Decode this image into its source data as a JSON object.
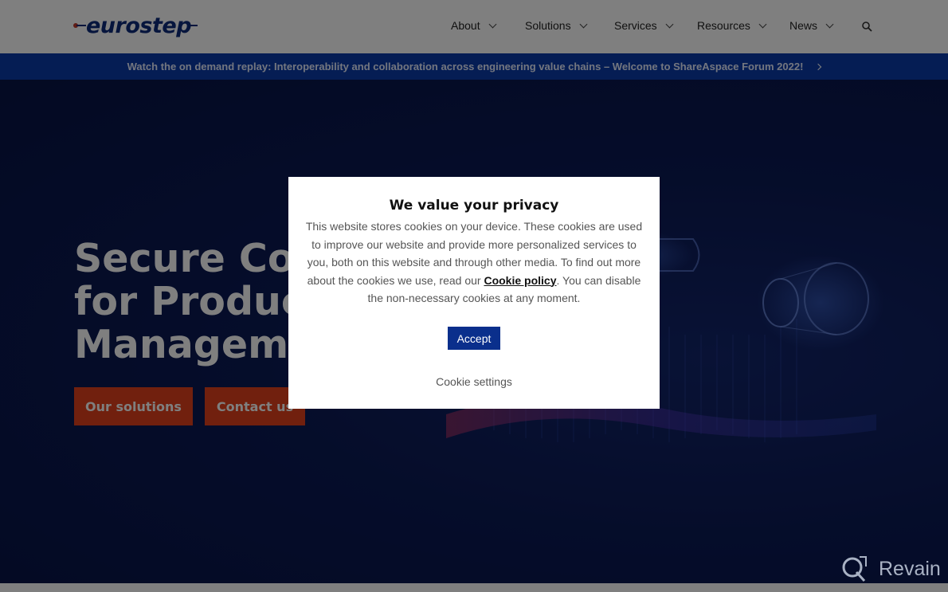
{
  "header": {
    "logo_text": "eurostep",
    "nav": [
      {
        "label": "About"
      },
      {
        "label": "Solutions"
      },
      {
        "label": "Services"
      },
      {
        "label": "Resources"
      },
      {
        "label": "News"
      }
    ],
    "search_icon": "search-icon"
  },
  "banner": {
    "text": "Watch the on demand replay: Interoperability and collaboration across engineering value chains – Welcome to ShareAspace Forum 2022!",
    "icon": "chevron-right-icon"
  },
  "hero": {
    "title": "Secure Collaboration\nfor Product Lifecycle\nManagement",
    "buttons": {
      "solutions": "Our solutions",
      "contact": "Contact us"
    }
  },
  "cookie_modal": {
    "title": "We value your privacy",
    "body_before": "This website stores cookies on your device. These cookies are used to improve our website and provide more personalized services to you, both on this website and through other media. To find out more about the cookies we use, read our ",
    "policy_link": "Cookie policy",
    "body_after": ". You can disable the non-necessary cookies at any moment.",
    "accept_label": "Accept",
    "settings_label": "Cookie settings"
  },
  "watermark": {
    "text": "Revain"
  },
  "colors": {
    "brand_blue": "#0d2a7a",
    "banner_blue": "#0a3aa8",
    "cta_orange": "#e2411c",
    "accept_blue": "#0a2f8c"
  }
}
